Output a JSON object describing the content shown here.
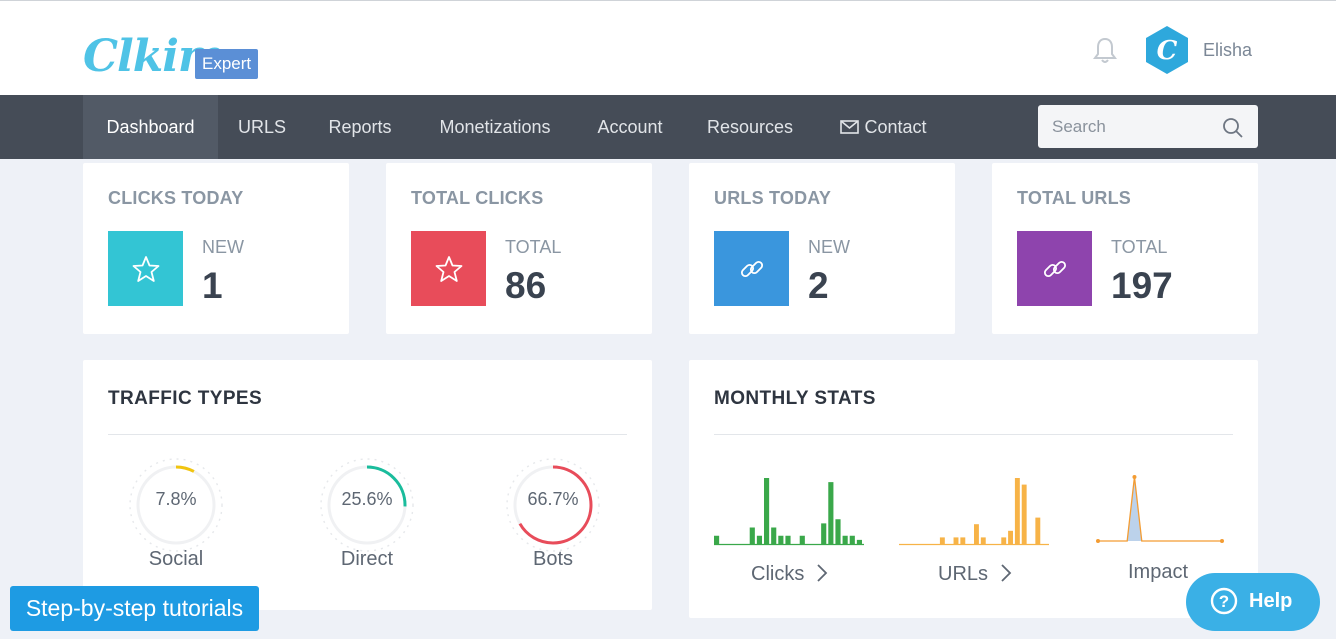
{
  "header": {
    "logo_text": "Clkim",
    "logo_badge": "Expert",
    "user_name": "Elisha"
  },
  "nav": {
    "items": [
      {
        "label": "Dashboard",
        "active": true
      },
      {
        "label": "URLS"
      },
      {
        "label": "Reports"
      },
      {
        "label": "Monetizations"
      },
      {
        "label": "Account"
      },
      {
        "label": "Resources"
      },
      {
        "label": "Contact",
        "icon": "envelope-icon"
      }
    ],
    "search_placeholder": "Search"
  },
  "stats": [
    {
      "title": "CLICKS TODAY",
      "label": "NEW",
      "value": "1",
      "icon": "star-icon",
      "color": "#33c5d4"
    },
    {
      "title": "TOTAL CLICKS",
      "label": "TOTAL",
      "value": "86",
      "icon": "star-icon",
      "color": "#e84c5a"
    },
    {
      "title": "URLS TODAY",
      "label": "NEW",
      "value": "2",
      "icon": "link-icon",
      "color": "#3a96dd"
    },
    {
      "title": "TOTAL URLS",
      "label": "TOTAL",
      "value": "197",
      "icon": "link-icon",
      "color": "#8e44ad"
    }
  ],
  "traffic": {
    "title": "TRAFFIC TYPES",
    "gauges": [
      {
        "pct": "7.8%",
        "value": 7.8,
        "label": "Social",
        "color": "#f1c40f"
      },
      {
        "pct": "25.6%",
        "value": 25.6,
        "label": "Direct",
        "color": "#1abc9c"
      },
      {
        "pct": "66.7%",
        "value": 66.7,
        "label": "Bots",
        "color": "#e84c5a"
      }
    ]
  },
  "monthly": {
    "title": "MONTHLY STATS",
    "clicks_label": "Clicks",
    "urls_label": "URLs",
    "impact_label": "Impact"
  },
  "chart_data": [
    {
      "type": "bar",
      "label": "Clicks",
      "color": "#3aa84a",
      "values": [
        2,
        0,
        0,
        0,
        0,
        4,
        2,
        16,
        4,
        2,
        2,
        0,
        2,
        0,
        0,
        5,
        15,
        6,
        2,
        2,
        1
      ]
    },
    {
      "type": "bar",
      "label": "URLs",
      "color": "#f7b347",
      "values": [
        0,
        0,
        0,
        0,
        0,
        0,
        1,
        0,
        1,
        1,
        0,
        3,
        1,
        0,
        0,
        1,
        2,
        10,
        9,
        0,
        4,
        0
      ]
    },
    {
      "type": "area",
      "label": "Impact",
      "color": "#8fb4de",
      "values": [
        0,
        0,
        0,
        0,
        0,
        1,
        0,
        0,
        0,
        0,
        0,
        0,
        0,
        0,
        0,
        0,
        0,
        0
      ]
    }
  ],
  "floating": {
    "tutorials": "Step-by-step tutorials",
    "help": "Help"
  }
}
